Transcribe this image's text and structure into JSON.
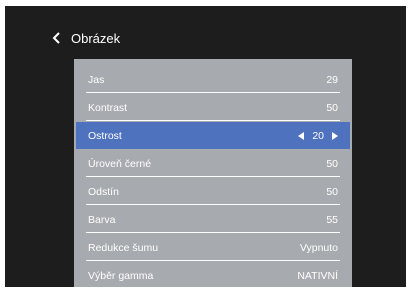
{
  "header": {
    "title": "Obrázek",
    "back_icon": "chevron-left-icon"
  },
  "menu": {
    "items": [
      {
        "label": "Jas",
        "value": "29"
      },
      {
        "label": "Kontrast",
        "value": "50"
      },
      {
        "label": "Ostrost",
        "value": "20",
        "selected": true
      },
      {
        "label": "Úroveň černé",
        "value": "50"
      },
      {
        "label": "Odstín",
        "value": "50"
      },
      {
        "label": "Barva",
        "value": "55"
      },
      {
        "label": "Redukce šumu",
        "value": "Vypnuto"
      },
      {
        "label": "Výběr gamma",
        "value": "NATIVNÍ"
      }
    ]
  },
  "colors": {
    "background": "#1d1d1d",
    "panel": "#a7aaaf",
    "selected": "#4f72bf",
    "text": "#ffffff"
  }
}
